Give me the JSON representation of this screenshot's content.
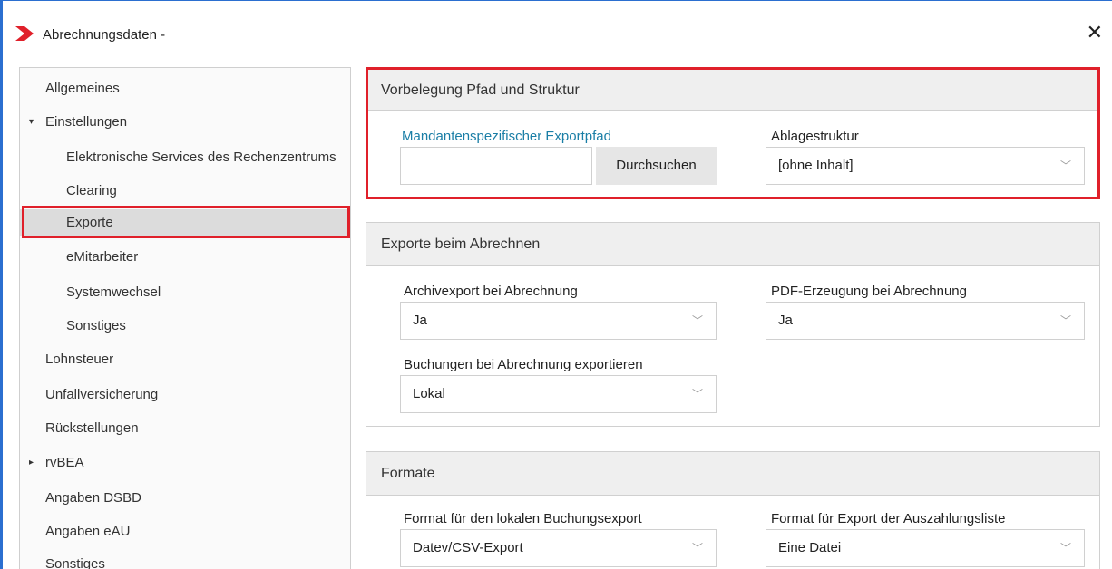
{
  "window": {
    "title": "Abrechnungsdaten -",
    "close_glyph": "✕",
    "accent_color": "#e0202a",
    "border_color": "#2b6fd0"
  },
  "sidebar": {
    "items": [
      {
        "label": "Allgemeines"
      },
      {
        "label": "Einstellungen",
        "caret": "▾"
      },
      {
        "label": "Elektronische Services des Rechenzentrums"
      },
      {
        "label": "Clearing"
      },
      {
        "label": "Exporte"
      },
      {
        "label": "eMitarbeiter"
      },
      {
        "label": "Systemwechsel"
      },
      {
        "label": "Sonstiges"
      },
      {
        "label": "Lohnsteuer"
      },
      {
        "label": "Unfallversicherung"
      },
      {
        "label": "Rückstellungen"
      },
      {
        "label": "rvBEA",
        "caret": "▸"
      },
      {
        "label": "Angaben DSBD"
      },
      {
        "label": "Angaben eAU"
      },
      {
        "label": "Sonstiges"
      }
    ]
  },
  "sections": {
    "vorbelegung": {
      "title": "Vorbelegung Pfad und Struktur",
      "export_path_label": "Mandantenspezifischer Exportpfad",
      "export_path_value": "",
      "browse_button": "Durchsuchen",
      "structure_label": "Ablagestruktur",
      "structure_value": "[ohne Inhalt]"
    },
    "exporte": {
      "title": "Exporte beim Abrechnen",
      "archive_label": "Archivexport bei Abrechnung",
      "archive_value": "Ja",
      "pdf_label": "PDF-Erzeugung bei Abrechnung",
      "pdf_value": "Ja",
      "bookings_label": "Buchungen bei Abrechnung exportieren",
      "bookings_value": "Lokal"
    },
    "formate": {
      "title": "Formate",
      "local_format_label": "Format für den lokalen Buchungsexport",
      "local_format_value": "Datev/CSV-Export",
      "payout_format_label": "Format für Export der Auszahlungsliste",
      "payout_format_value": "Eine Datei"
    }
  },
  "icons": {
    "chevron": "﹀"
  }
}
